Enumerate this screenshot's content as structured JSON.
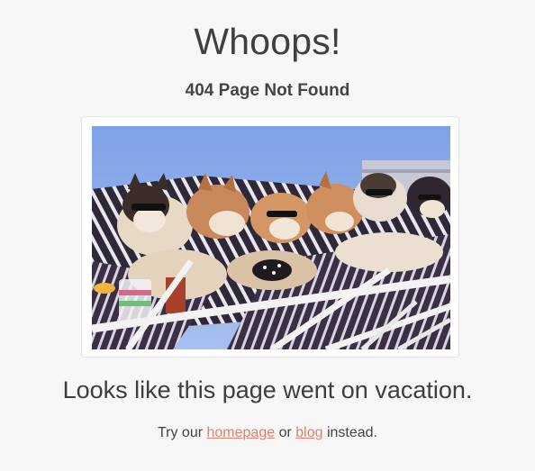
{
  "header": {
    "title": "Whoops!",
    "subtitle": "404 Page Not Found"
  },
  "image": {
    "description_icon": "vacation-huskies-image"
  },
  "main": {
    "headline": "Looks like this page went on vacation."
  },
  "footer": {
    "prefix": "Try our",
    "homepage_link": "homepage",
    "connector": "or",
    "blog_link": "blog",
    "suffix": "instead."
  },
  "colors": {
    "background": "#f7f7f7",
    "text": "#3e3e3e",
    "link": "#e08068"
  }
}
